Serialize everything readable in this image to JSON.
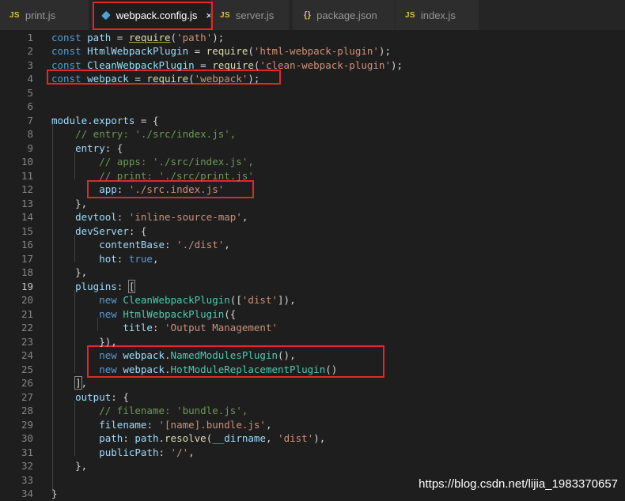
{
  "tabs": [
    {
      "icon": "JS",
      "label": "print.js",
      "active": false
    },
    {
      "icon": "config",
      "label": "webpack.config.js",
      "active": true,
      "close": "×"
    },
    {
      "icon": "JS",
      "label": "server.js",
      "active": false
    },
    {
      "icon": "{}",
      "label": "package.json",
      "active": false
    },
    {
      "icon": "JS",
      "label": "index.js",
      "active": false
    }
  ],
  "current_line": 19,
  "lines": [
    {
      "n": 1,
      "tokens": [
        [
          "kw",
          "const "
        ],
        [
          "var",
          "path"
        ],
        [
          "pun",
          " = "
        ],
        [
          "fn",
          "require",
          "u"
        ],
        [
          "pun",
          "("
        ],
        [
          "str",
          "'path'"
        ],
        [
          "pun",
          ");"
        ]
      ]
    },
    {
      "n": 2,
      "tokens": [
        [
          "kw",
          "const "
        ],
        [
          "var",
          "HtmlWebpackPlugin"
        ],
        [
          "pun",
          " = "
        ],
        [
          "fn",
          "require"
        ],
        [
          "pun",
          "("
        ],
        [
          "str",
          "'html-webpack-plugin'"
        ],
        [
          "pun",
          ");"
        ]
      ]
    },
    {
      "n": 3,
      "tokens": [
        [
          "kw",
          "const "
        ],
        [
          "var",
          "CleanWebpackPlugin"
        ],
        [
          "pun",
          " = "
        ],
        [
          "fn",
          "require"
        ],
        [
          "pun",
          "("
        ],
        [
          "str",
          "'clean-webpack-plugin'"
        ],
        [
          "pun",
          ");"
        ]
      ]
    },
    {
      "n": 4,
      "tokens": [
        [
          "kw",
          "const "
        ],
        [
          "var",
          "webpack"
        ],
        [
          "pun",
          " = "
        ],
        [
          "fn",
          "require"
        ],
        [
          "pun",
          "("
        ],
        [
          "str",
          "'webpack'"
        ],
        [
          "pun",
          ");"
        ]
      ]
    },
    {
      "n": 5,
      "tokens": []
    },
    {
      "n": 6,
      "tokens": []
    },
    {
      "n": 7,
      "tokens": [
        [
          "var",
          "module"
        ],
        [
          "pun",
          "."
        ],
        [
          "var",
          "exports"
        ],
        [
          "pun",
          " = {"
        ]
      ]
    },
    {
      "n": 8,
      "tokens": [
        [
          "pun",
          "    "
        ],
        [
          "com",
          "// entry: './src/index.js',"
        ]
      ]
    },
    {
      "n": 9,
      "tokens": [
        [
          "pun",
          "    "
        ],
        [
          "var",
          "entry"
        ],
        [
          "pun",
          ": {"
        ]
      ]
    },
    {
      "n": 10,
      "tokens": [
        [
          "pun",
          "        "
        ],
        [
          "com",
          "// apps: './src/index.js',"
        ]
      ]
    },
    {
      "n": 11,
      "tokens": [
        [
          "pun",
          "        "
        ],
        [
          "com",
          "// print: './src/print.js'"
        ]
      ]
    },
    {
      "n": 12,
      "tokens": [
        [
          "pun",
          "        "
        ],
        [
          "var",
          "app"
        ],
        [
          "pun",
          ": "
        ],
        [
          "str",
          "'./src.index.js'"
        ]
      ]
    },
    {
      "n": 13,
      "tokens": [
        [
          "pun",
          "    },"
        ]
      ]
    },
    {
      "n": 14,
      "tokens": [
        [
          "pun",
          "    "
        ],
        [
          "var",
          "devtool"
        ],
        [
          "pun",
          ": "
        ],
        [
          "str",
          "'inline-source-map'"
        ],
        [
          "pun",
          ","
        ]
      ]
    },
    {
      "n": 15,
      "tokens": [
        [
          "pun",
          "    "
        ],
        [
          "var",
          "devServer"
        ],
        [
          "pun",
          ": {"
        ]
      ]
    },
    {
      "n": 16,
      "tokens": [
        [
          "pun",
          "        "
        ],
        [
          "var",
          "contentBase"
        ],
        [
          "pun",
          ": "
        ],
        [
          "str",
          "'./dist'"
        ],
        [
          "pun",
          ","
        ]
      ]
    },
    {
      "n": 17,
      "tokens": [
        [
          "pun",
          "        "
        ],
        [
          "var",
          "hot"
        ],
        [
          "pun",
          ": "
        ],
        [
          "bool",
          "true"
        ],
        [
          "pun",
          ","
        ]
      ]
    },
    {
      "n": 18,
      "tokens": [
        [
          "pun",
          "    },"
        ]
      ]
    },
    {
      "n": 19,
      "tokens": [
        [
          "pun",
          "    "
        ],
        [
          "var",
          "plugins"
        ],
        [
          "pun",
          ": "
        ],
        [
          "pun",
          "[",
          "b"
        ]
      ]
    },
    {
      "n": 20,
      "tokens": [
        [
          "pun",
          "        "
        ],
        [
          "kw",
          "new "
        ],
        [
          "cls",
          "CleanWebpackPlugin"
        ],
        [
          "pun",
          "(["
        ],
        [
          "str",
          "'dist'"
        ],
        [
          "pun",
          "]),"
        ]
      ]
    },
    {
      "n": 21,
      "tokens": [
        [
          "pun",
          "        "
        ],
        [
          "kw",
          "new "
        ],
        [
          "cls",
          "HtmlWebpackPlugin"
        ],
        [
          "pun",
          "({"
        ]
      ]
    },
    {
      "n": 22,
      "tokens": [
        [
          "pun",
          "            "
        ],
        [
          "var",
          "title"
        ],
        [
          "pun",
          ": "
        ],
        [
          "str",
          "'Output Management'"
        ]
      ]
    },
    {
      "n": 23,
      "tokens": [
        [
          "pun",
          "        }),"
        ]
      ]
    },
    {
      "n": 24,
      "tokens": [
        [
          "pun",
          "        "
        ],
        [
          "kw",
          "new "
        ],
        [
          "var",
          "webpack"
        ],
        [
          "pun",
          "."
        ],
        [
          "cls",
          "NamedModulesPlugin"
        ],
        [
          "pun",
          "(),"
        ]
      ]
    },
    {
      "n": 25,
      "tokens": [
        [
          "pun",
          "        "
        ],
        [
          "kw",
          "new "
        ],
        [
          "var",
          "webpack"
        ],
        [
          "pun",
          "."
        ],
        [
          "cls",
          "HotModuleReplacementPlugin"
        ],
        [
          "pun",
          "()"
        ]
      ]
    },
    {
      "n": 26,
      "tokens": [
        [
          "pun",
          "    "
        ],
        [
          "pun",
          "]",
          "b"
        ],
        [
          "pun",
          ","
        ]
      ]
    },
    {
      "n": 27,
      "tokens": [
        [
          "pun",
          "    "
        ],
        [
          "var",
          "output"
        ],
        [
          "pun",
          ": {"
        ]
      ]
    },
    {
      "n": 28,
      "tokens": [
        [
          "pun",
          "        "
        ],
        [
          "com",
          "// filename: 'bundle.js',"
        ]
      ]
    },
    {
      "n": 29,
      "tokens": [
        [
          "pun",
          "        "
        ],
        [
          "var",
          "filename"
        ],
        [
          "pun",
          ": "
        ],
        [
          "str",
          "'[name].bundle.js'"
        ],
        [
          "pun",
          ","
        ]
      ]
    },
    {
      "n": 30,
      "tokens": [
        [
          "pun",
          "        "
        ],
        [
          "var",
          "path"
        ],
        [
          "pun",
          ": "
        ],
        [
          "var",
          "path"
        ],
        [
          "pun",
          "."
        ],
        [
          "fn",
          "resolve"
        ],
        [
          "pun",
          "("
        ],
        [
          "var",
          "__dirname"
        ],
        [
          "pun",
          ", "
        ],
        [
          "str",
          "'dist'"
        ],
        [
          "pun",
          "),"
        ]
      ]
    },
    {
      "n": 31,
      "tokens": [
        [
          "pun",
          "        "
        ],
        [
          "var",
          "publicPath"
        ],
        [
          "pun",
          ": "
        ],
        [
          "str",
          "'/'"
        ],
        [
          "pun",
          ","
        ]
      ]
    },
    {
      "n": 32,
      "tokens": [
        [
          "pun",
          "    },"
        ]
      ]
    },
    {
      "n": 33,
      "tokens": []
    },
    {
      "n": 34,
      "tokens": [
        [
          "pun",
          "}"
        ]
      ]
    }
  ],
  "watermark": "https://blog.csdn.net/lijia_1983370657"
}
